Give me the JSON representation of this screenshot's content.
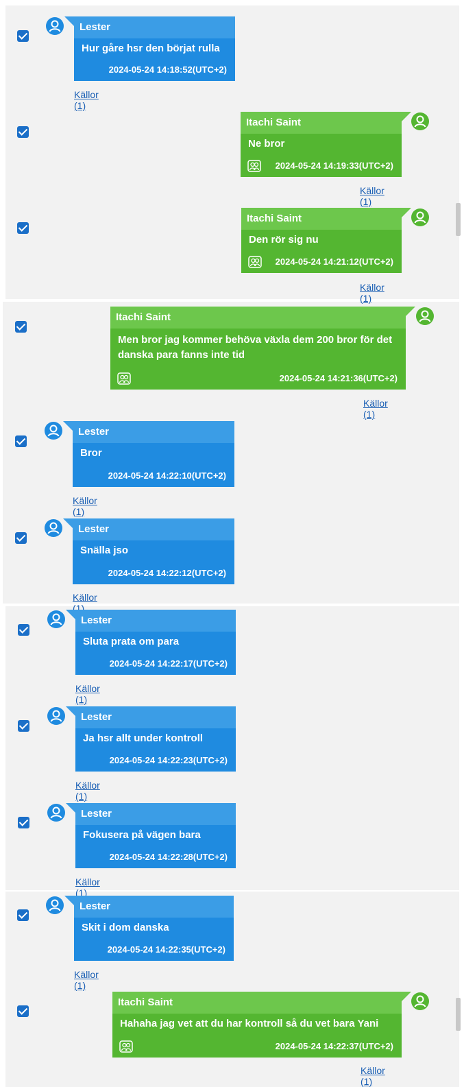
{
  "source_link_label": "Källor (1)",
  "messages": [
    {
      "sender": "Lester",
      "text": "Hur gåre hsr den börjat rulla",
      "time": "2024-05-24 14:18:52(UTC+2)",
      "side": "left",
      "checked": true
    },
    {
      "sender": "Itachi Saint",
      "text": "Ne bror",
      "time": "2024-05-24 14:19:33(UTC+2)",
      "side": "right",
      "checked": true
    },
    {
      "sender": "Itachi Saint",
      "text": "Den rör sig nu",
      "time": "2024-05-24 14:21:12(UTC+2)",
      "side": "right",
      "checked": true
    },
    {
      "sender": "Itachi Saint",
      "text": "Men bror jag kommer behöva växla dem 200 bror för det danska para fanns inte tid",
      "time": "2024-05-24 14:21:36(UTC+2)",
      "side": "right",
      "checked": true
    },
    {
      "sender": "Lester",
      "text": "Bror",
      "time": "2024-05-24 14:22:10(UTC+2)",
      "side": "left",
      "checked": true
    },
    {
      "sender": "Lester",
      "text": "Snälla jso",
      "time": "2024-05-24 14:22:12(UTC+2)",
      "side": "left",
      "checked": true
    },
    {
      "sender": "Lester",
      "text": "Sluta prata om para",
      "time": "2024-05-24 14:22:17(UTC+2)",
      "side": "left",
      "checked": true
    },
    {
      "sender": "Lester",
      "text": "Ja hsr allt under kontroll",
      "time": "2024-05-24 14:22:23(UTC+2)",
      "side": "left",
      "checked": true
    },
    {
      "sender": "Lester",
      "text": "Fokusera på vägen bara",
      "time": "2024-05-24 14:22:28(UTC+2)",
      "side": "left",
      "checked": true
    },
    {
      "sender": "Lester",
      "text": "Skit i dom danska",
      "time": "2024-05-24 14:22:35(UTC+2)",
      "side": "left",
      "checked": true
    },
    {
      "sender": "Itachi Saint",
      "text": "Hahaha jag vet att du har kontroll så du vet bara Yani",
      "time": "2024-05-24 14:22:37(UTC+2)",
      "side": "right",
      "checked": true
    }
  ],
  "colors": {
    "incoming": "#1f8be0",
    "outgoing": "#54b631",
    "checkbox": "#1b6fc8",
    "link": "#1a5fb4"
  },
  "icons": {
    "avatar": "person-circle-icon",
    "attachment": "contacts-icon",
    "checkbox": "checkmark-icon"
  }
}
